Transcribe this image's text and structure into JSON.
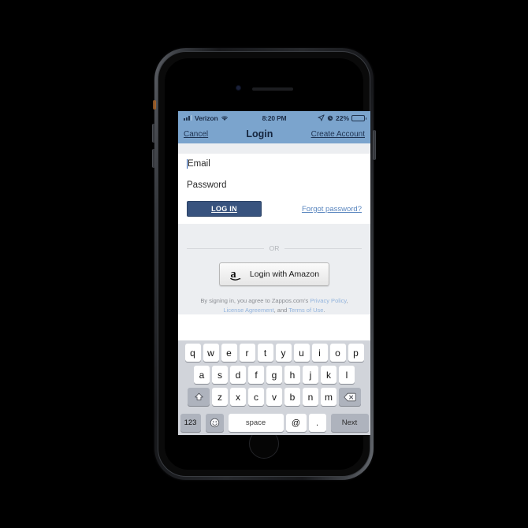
{
  "device": {
    "type": "iphone",
    "home_button": "home-button",
    "camera": "front-camera",
    "earpiece": "earpiece-speaker"
  },
  "status_bar": {
    "carrier": "Verizon",
    "signal_bars_filled": 3,
    "signal_bars_total": 4,
    "wifi": "wifi-icon",
    "time": "8:20 PM",
    "location_icon": "location-arrow-icon",
    "alarm_icon": "alarm-clock-icon",
    "battery_percent": "22%",
    "battery_level": 22
  },
  "nav_bar": {
    "cancel_label": "Cancel",
    "title": "Login",
    "create_account_label": "Create Account",
    "background": "#7ba4cd",
    "title_color": "#14243d"
  },
  "form": {
    "email": {
      "placeholder": "Email",
      "value": "",
      "focused": true
    },
    "password": {
      "placeholder": "Password",
      "value": "",
      "focused": false
    },
    "login_button": {
      "label": "LOG IN",
      "color": "#38537e"
    },
    "forgot_password_label": "Forgot password?"
  },
  "alt_login": {
    "divider_label": "OR",
    "amazon_button_label": "Login with Amazon",
    "amazon_icon": "amazon-a-logo"
  },
  "legal": {
    "intro": "By signing in, you agree to Zappos.com's ",
    "privacy_policy": "Privacy Policy",
    "sep1": ", ",
    "license_agreement": "License Agreement",
    "sep2": ", and ",
    "terms_of_use": "Terms of Use",
    "period": "."
  },
  "keyboard": {
    "row1": [
      "q",
      "w",
      "e",
      "r",
      "t",
      "y",
      "u",
      "i",
      "o",
      "p"
    ],
    "row2": [
      "a",
      "s",
      "d",
      "f",
      "g",
      "h",
      "j",
      "k",
      "l"
    ],
    "row3": [
      "z",
      "x",
      "c",
      "v",
      "b",
      "n",
      "m"
    ],
    "shift_icon": "shift-arrow-icon",
    "backspace_icon": "backspace-icon",
    "numbers_label": "123",
    "emoji_icon": "emoji-smiley-icon",
    "space_label": "space",
    "at_label": "@",
    "period_label": ".",
    "return_label": "Next"
  }
}
